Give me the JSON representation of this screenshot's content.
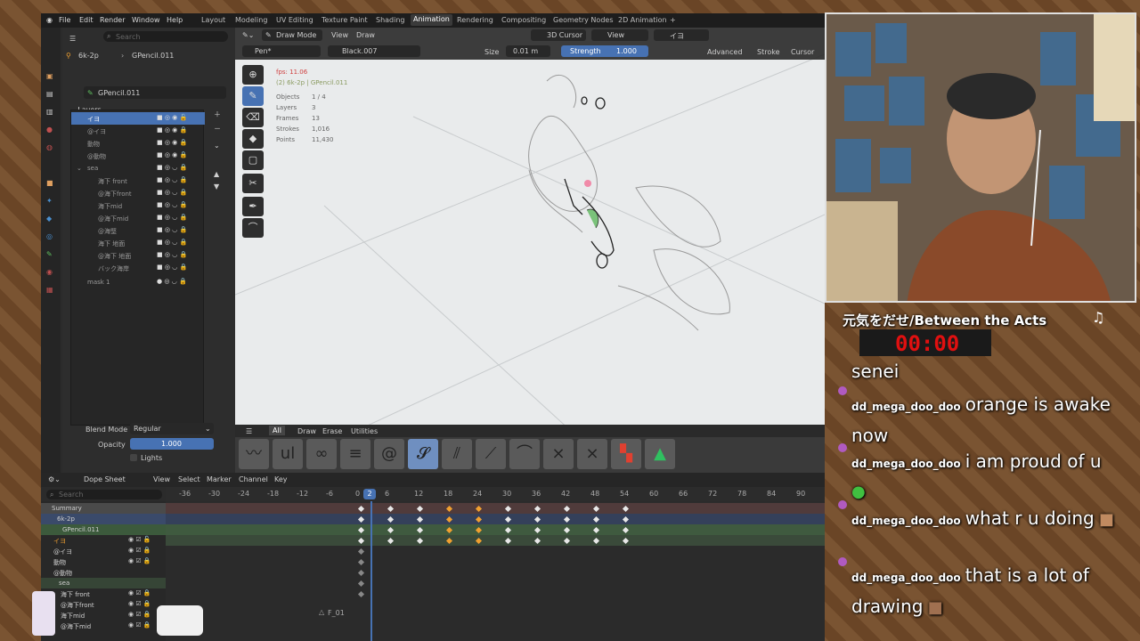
{
  "menu": {
    "items": [
      "File",
      "Edit",
      "Render",
      "Window",
      "Help"
    ],
    "workspaces": [
      "Layout",
      "Modeling",
      "UV Editing",
      "Texture Paint",
      "Shading",
      "Animation",
      "Rendering",
      "Compositing",
      "Geometry Nodes",
      "2D Animation",
      "+"
    ],
    "active_workspace": "Animation"
  },
  "outliner": {
    "search_placeholder": "Search",
    "scene": "6k-2p",
    "object": "GPencil.011",
    "data_name": "GPencil.011",
    "layers_title": "Layers",
    "layers": [
      "イヨ",
      "@イヨ",
      "動物",
      "@動物",
      "sea",
      "海下 front",
      "@海下front",
      "海下mid",
      "@海下mid",
      "@海堅",
      "海下 地面",
      "@海下 地面",
      "バック海岸",
      "mask 1"
    ],
    "blend_mode_label": "Blend Mode",
    "blend_mode_value": "Regular",
    "opacity_label": "Opacity",
    "opacity_value": "1.000",
    "lights_label": "Lights"
  },
  "viewport_header": {
    "mode": "Draw Mode",
    "view": "View",
    "draw": "Draw",
    "cursor_dd": "3D Cursor",
    "view_dd": "View",
    "layer_dd": "イヨ",
    "brush": "Pen*",
    "material": "Black.007",
    "size_label": "Size",
    "size_value": "0.01 m",
    "strength_label": "Strength",
    "strength_value": "1.000",
    "advanced": "Advanced",
    "stroke": "Stroke",
    "cursor": "Cursor"
  },
  "stats": {
    "fps": "fps: 11.06",
    "context": "(2) 6k-2p | GPencil.011",
    "objects_label": "Objects",
    "objects": "1 / 4",
    "layers_label": "Layers",
    "layers": "3",
    "frames_label": "Frames",
    "frames": "13",
    "strokes_label": "Strokes",
    "strokes": "1,016",
    "points_label": "Points",
    "points": "11,430"
  },
  "brush_tabs": [
    "All",
    "Draw",
    "Erase",
    "Utilities"
  ],
  "dopesheet": {
    "editor": "Dope Sheet",
    "menus": [
      "View",
      "Select",
      "Marker",
      "Channel",
      "Key"
    ],
    "search_placeholder": "Search",
    "current_frame": "2",
    "ticks": [
      "-36",
      "-30",
      "-24",
      "-18",
      "-12",
      "-6",
      "0",
      "6",
      "12",
      "18",
      "24",
      "30",
      "36",
      "42",
      "48",
      "54",
      "60",
      "66",
      "72",
      "78",
      "84",
      "90"
    ],
    "marker": "F_01",
    "channels": [
      "Summary",
      "6k-2p",
      "GPencil.011",
      "イヨ",
      "@イヨ",
      "動物",
      "@動物",
      "sea",
      "海下 front",
      "@海下front",
      "海下mid",
      "@海下mid"
    ]
  },
  "stream": {
    "song_title": "元気をだせ/Between the Acts",
    "music_icon": "music-note-icon",
    "timer": "00:00",
    "messages": [
      {
        "user": "",
        "text": "senei"
      },
      {
        "user": "dd_mega_doo_doo",
        "text": "orange is awake now"
      },
      {
        "user": "dd_mega_doo_doo",
        "text": "i am proud of u"
      },
      {
        "user": "dd_mega_doo_doo",
        "text": "what r u doing"
      },
      {
        "user": "dd_mega_doo_doo",
        "text": "that is a lot of drawing"
      }
    ]
  },
  "colors": {
    "accent": "#4772b3",
    "timer_red": "#e01010",
    "frame_marker": "#4772b3"
  }
}
